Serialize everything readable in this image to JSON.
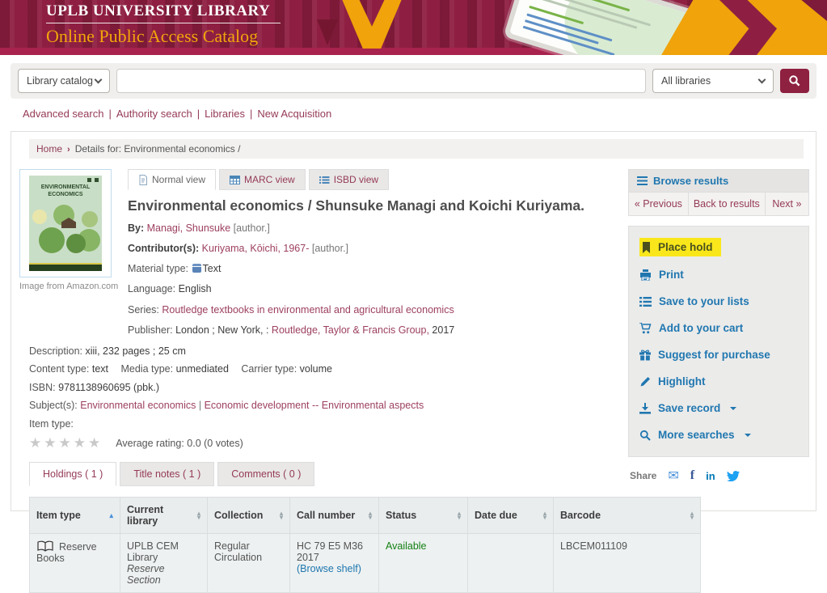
{
  "header": {
    "library_name": "UPLB UNIVERSITY LIBRARY",
    "catalog_name": "Online Public Access Catalog"
  },
  "search": {
    "catalog_select": "Library catalog",
    "input_value": "",
    "libraries_select": "All libraries"
  },
  "nav": {
    "separator": "|",
    "links": [
      "Advanced search",
      "Authority search",
      "Libraries",
      "New Acquisition"
    ]
  },
  "breadcrumb": {
    "home": "Home",
    "separator": "›",
    "current": "Details for: Environmental economics /"
  },
  "view_tabs": [
    {
      "label": "Normal view"
    },
    {
      "label": "MARC view"
    },
    {
      "label": "ISBD view"
    }
  ],
  "record": {
    "cover_title": "ENVIRONMENTAL ECONOMICS",
    "cover_caption": "Image from Amazon.com",
    "title": "Environmental economics / Shunsuke Managi and Koichi Kuriyama.",
    "by_label": "By:",
    "by_author": "Managi, Shunsuke",
    "by_role": "[author.]",
    "contributor_label": "Contributor(s):",
    "contributor": "Kuriyama, Kōichi, 1967-",
    "contributor_role": "[author.]",
    "material_type_label": "Material type:",
    "material_type": "Text",
    "language_label": "Language:",
    "language": "English",
    "series_label": "Series:",
    "series": "Routledge textbooks in environmental and agricultural economics",
    "publisher_label": "Publisher:",
    "publisher_place": "London ; New York, :",
    "publisher_name": "Routledge, Taylor & Francis Group,",
    "publisher_year": "2017",
    "description_label": "Description:",
    "description": "xiii, 232 pages ; 25 cm",
    "content_type_label": "Content type:",
    "content_type": "text",
    "media_type_label": "Media type:",
    "media_type": "unmediated",
    "carrier_type_label": "Carrier type:",
    "carrier_type": "volume",
    "isbn_label": "ISBN:",
    "isbn": "9781138960695 (pbk.)",
    "subjects_label": "Subject(s):",
    "subject_1": "Environmental economics",
    "subject_separator": "|",
    "subject_2": "Economic development -- Environmental aspects",
    "item_type_label": "Item type:",
    "star_glyph": "★",
    "rating_text": "Average rating: 0.0 (0 votes)"
  },
  "sidebar": {
    "browse_results": "Browse results",
    "pager": [
      {
        "label": "« Previous"
      },
      {
        "label": "Back to results"
      },
      {
        "label": "Next »"
      }
    ],
    "actions": [
      {
        "label": "Place hold"
      },
      {
        "label": "Print"
      },
      {
        "label": "Save to your lists"
      },
      {
        "label": "Add to your cart"
      },
      {
        "label": "Suggest for purchase"
      },
      {
        "label": "Highlight"
      },
      {
        "label": "Save record"
      },
      {
        "label": "More searches"
      }
    ],
    "share_label": "Share",
    "share_icons": {
      "envelope": "✉",
      "facebook": "f",
      "linkedin": "in"
    }
  },
  "holdings": {
    "tabs": [
      {
        "label": "Holdings ( 1 )"
      },
      {
        "label": "Title notes ( 1 )"
      },
      {
        "label": "Comments ( 0 )"
      }
    ],
    "sort_asc": "▴",
    "sort_desc": "▾",
    "columns": [
      {
        "label": "Item type"
      },
      {
        "label": "Current library"
      },
      {
        "label": "Collection"
      },
      {
        "label": "Call number"
      },
      {
        "label": "Status"
      },
      {
        "label": "Date due"
      },
      {
        "label": "Barcode"
      }
    ],
    "row": {
      "item_type": "Reserve Books",
      "library": "UPLB CEM Library",
      "library_section": "Reserve Section",
      "collection": "Regular Circulation",
      "call_number": "HC 79 E5 M36 2017",
      "call_number_link": "(Browse shelf)",
      "status": "Available",
      "date_due": "",
      "barcode": "LBCEM011109"
    }
  },
  "colors": {
    "maroon": "#8e1f42",
    "gold": "#f0a30a",
    "link_maroon": "#953a56",
    "link_blue": "#2077b0",
    "highlight_yellow": "#f9e71b",
    "available_green": "#158015"
  }
}
